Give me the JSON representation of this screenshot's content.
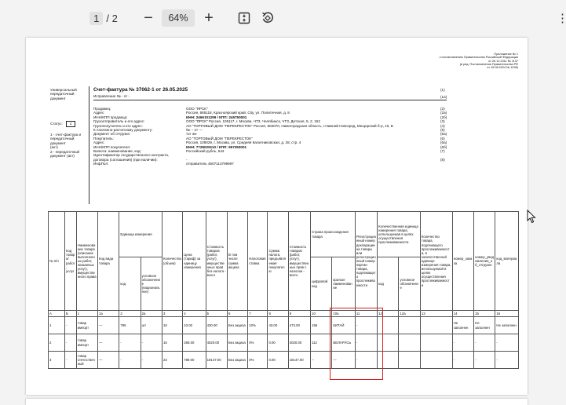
{
  "toolbar": {
    "page_current": "1",
    "page_sep": "/ 2",
    "zoom_out": "−",
    "zoom_value": "64%",
    "zoom_in": "+",
    "more": "⋮",
    "fit_icon": "fit-page-icon",
    "rotate_icon": "rotate-icon"
  },
  "doc": {
    "appendix": [
      "Приложение № 1",
      "к постановлению Правительства Российской Федерации",
      "от 26.12.2011 № 1137",
      "(в ред. Постановления Правительства РФ",
      "от 16.08.2024 № 1096)"
    ],
    "upd_label": [
      "Универсальный",
      "передаточный",
      "документ"
    ],
    "title": "Счет-фактура № 37062-1  от 26.05.2025",
    "title_code": "(1)",
    "correction": "Исправление № - от -",
    "correction_code": "(1а)",
    "status_label": "Статус:",
    "status_value": "1",
    "status_desc": [
      "1 - счет-фактура и",
      "передаточный",
      "документ",
      "(акт)",
      "2 - передаточный",
      "документ (акт)"
    ],
    "fields": [
      {
        "label": "Продавец:",
        "value": "ООО \"ЯРСК\"",
        "code": "(2)"
      },
      {
        "label": "Адрес:",
        "value": "Россия, 665118, Красноярский край, City, ул. Политичная, д. 8",
        "code": "(2а)"
      },
      {
        "label": "ИНН/КПП продавца:",
        "value": "ИНН: 2466101299  /  КПП: 246750001",
        "code": "(2б)"
      },
      {
        "label": "Грузоотправитель и его адрес:",
        "value": "ООО \"ЯРСК\" Россия, 105117, г. Москва, ЧТЗ, Челябинск, ЧТЗ, Детская, 5, 2, 152",
        "code": "(3)"
      },
      {
        "label": "Грузополучатель и его адрес:",
        "value": "АО \"ТОРГОВЫЙ ДОМ \"ПЕРЕКРЕСТОК\" Россия, 603070, Нижегородская область, г.Нижний Новгород, Мещерский б-р, 10, Б",
        "code": "(4)"
      },
      {
        "label": "К платежно-расчетному документу:",
        "value": "№  --  от  ---",
        "code": "(5)"
      },
      {
        "label": "Документ об отгрузке:",
        "value": "тот же",
        "code": "(5а)"
      },
      {
        "label": "Покупатель:",
        "value": "АО \"ТОРГОВЫЙ ДОМ \"ПЕРЕКРЕСТОК\"",
        "code": "(6)"
      },
      {
        "label": "Адрес:",
        "value": "Россия, 109029, г. Москва, ул. Средняя Калитниковская, д. 28, стр. 4",
        "code": "(6а)"
      },
      {
        "label": "ИНН/КПП покупателя:",
        "value": "ИНН: 7728029110  /  КПП: 997350001",
        "code": "(6б)"
      },
      {
        "label": "Валюта: наименование, код:",
        "value": "Российский рубль,  643",
        "code": "(7)"
      },
      {
        "label": "Идентификатор государственного контракта, договора (соглашения) (при наличии):",
        "value": "-",
        "code": "(8)"
      },
      {
        "label": "ИнфПол:",
        "value": "отправитель 4607113799997",
        "code": ""
      }
    ],
    "table": {
      "headers": {
        "num": "№ п/п",
        "code": "Код товара/ работ, услуг",
        "name": "Наименование товара (описание выполненных работ, оказанных услуг), имущественного права",
        "kind": "Код вида товара",
        "unit": "Единица измерения",
        "unit_code": "код",
        "unit_name": "условное обозначение (национальное)",
        "qty": "Количество (объем)",
        "price": "Цена (тариф) за единицу измерения",
        "cost_no_tax": "Стоимость товаров (работ, услуг), имущественных прав без налога - всего",
        "excise": "В том числе сумма акциза",
        "rate": "Налоговая ставка",
        "tax": "Сумма налога, предъявляемая покупателю",
        "cost_tax": "Стоимость товаров (работ, услуг), имущественных прав с налогом - всего",
        "country": "Страна происхождения товара",
        "country_code": "цифровой код",
        "country_name": "краткое наименование",
        "customs": "Регистрационный номер декларации на товары или регистрационный номер партии товара, подлежащего прослеживаемости",
        "trace_unit": "Количественная единица измерения товара, используемая в целях осуществления прослеживаемости",
        "trace_code": "код",
        "trace_name": "условное обозначение",
        "trace_qty": "Количество товара, подлежащего прослеживаемости, в количественной единице измерения товара, используемой в целях осуществления прослеживаемости",
        "c14": "номер_заказа",
        "c15": "номер_уведомления_об_отгрузке",
        "c16": "код_материала"
      },
      "index": [
        "А",
        "Б",
        "1",
        "1а",
        "2",
        "2а",
        "3",
        "4",
        "5",
        "6",
        "7",
        "8",
        "9",
        "10",
        "10а",
        "11",
        "12",
        "12а",
        "13",
        "14",
        "15",
        "16"
      ],
      "rows": [
        {
          "num": "1",
          "code": "-",
          "name": "товар импорт",
          "kind": "—",
          "unit_code": "796",
          "unit_name": "шт",
          "qty": "10",
          "price": "43.00",
          "cost": "430.00",
          "excise": "Без акциза",
          "rate": "10%",
          "tax": "43.00",
          "cost_tax": "473.00",
          "country_code": "156",
          "country_name": "КИТАЙ",
          "customs": "-",
          "tu_code": "",
          "tu_name": "",
          "tu_qty": "",
          "c14": "Не заполнен",
          "c15": "Не заполнен",
          "c16": "Не заполнен"
        },
        {
          "num": "2",
          "code": "-",
          "name": "товар импорт",
          "kind": "—",
          "unit_code": "-",
          "unit_name": "-",
          "qty": "15",
          "price": "268.00",
          "cost": "4020.00",
          "excise": "Без акциза",
          "rate": "0%",
          "tax": "0.00",
          "cost_tax": "4020.00",
          "country_code": "112",
          "country_name": "БЕЛАРУСЬ",
          "customs": "-",
          "tu_code": "",
          "tu_name": "",
          "tu_qty": "",
          "c14": "-",
          "c15": "-",
          "c16": "-"
        },
        {
          "num": "3",
          "code": "-",
          "name": "товар отечественный",
          "kind": "—",
          "unit_code": "-",
          "unit_name": "-",
          "qty": "23",
          "price": "789.00",
          "cost": "18147.00",
          "excise": "Без акциза",
          "rate": "0%",
          "tax": "0.00",
          "cost_tax": "18147.00",
          "country_code": "--",
          "country_name": "—",
          "customs": "-",
          "tu_code": "",
          "tu_name": "",
          "tu_qty": "",
          "c14": "-",
          "c15": "-",
          "c16": "-"
        }
      ]
    }
  }
}
